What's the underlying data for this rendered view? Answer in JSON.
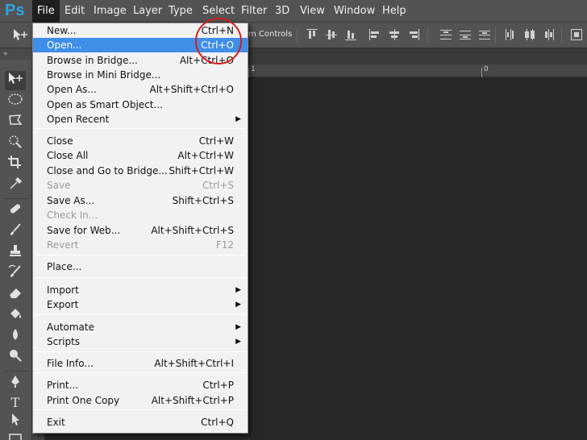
{
  "app": {
    "logo": "Ps"
  },
  "menubar": {
    "items": [
      "File",
      "Edit",
      "Image",
      "Layer",
      "Type",
      "Select",
      "Filter",
      "3D",
      "View",
      "Window",
      "Help"
    ]
  },
  "options_bar": {
    "transform_label": "m Controls"
  },
  "ruler": {
    "label_1": "1",
    "label_0": "0"
  },
  "file_menu": {
    "items": [
      {
        "label": "New...",
        "shortcut": "Ctrl+N"
      },
      {
        "label": "Open...",
        "shortcut": "Ctrl+O"
      },
      {
        "label": "Browse in Bridge...",
        "shortcut": "Alt+Ctrl+O"
      },
      {
        "label": "Browse in Mini Bridge...",
        "shortcut": ""
      },
      {
        "label": "Open As...",
        "shortcut": "Alt+Shift+Ctrl+O"
      },
      {
        "label": "Open as Smart Object...",
        "shortcut": ""
      },
      {
        "label": "Open Recent",
        "shortcut": ""
      },
      {
        "label": "Close",
        "shortcut": "Ctrl+W"
      },
      {
        "label": "Close All",
        "shortcut": "Alt+Ctrl+W"
      },
      {
        "label": "Close and Go to Bridge...",
        "shortcut": "Shift+Ctrl+W"
      },
      {
        "label": "Save",
        "shortcut": "Ctrl+S"
      },
      {
        "label": "Save As...",
        "shortcut": "Shift+Ctrl+S"
      },
      {
        "label": "Check In...",
        "shortcut": ""
      },
      {
        "label": "Save for Web...",
        "shortcut": "Alt+Shift+Ctrl+S"
      },
      {
        "label": "Revert",
        "shortcut": "F12"
      },
      {
        "label": "Place...",
        "shortcut": ""
      },
      {
        "label": "Import",
        "shortcut": ""
      },
      {
        "label": "Export",
        "shortcut": ""
      },
      {
        "label": "Automate",
        "shortcut": ""
      },
      {
        "label": "Scripts",
        "shortcut": ""
      },
      {
        "label": "File Info...",
        "shortcut": "Alt+Shift+Ctrl+I"
      },
      {
        "label": "Print...",
        "shortcut": "Ctrl+P"
      },
      {
        "label": "Print One Copy",
        "shortcut": "Alt+Shift+Ctrl+P"
      },
      {
        "label": "Exit",
        "shortcut": "Ctrl+Q"
      }
    ]
  },
  "colors": {
    "menubar_bg": "#535353",
    "menu_highlight": "#3f8ee8",
    "logo": "#2fa3e6",
    "annotation": "#d81c1c"
  }
}
